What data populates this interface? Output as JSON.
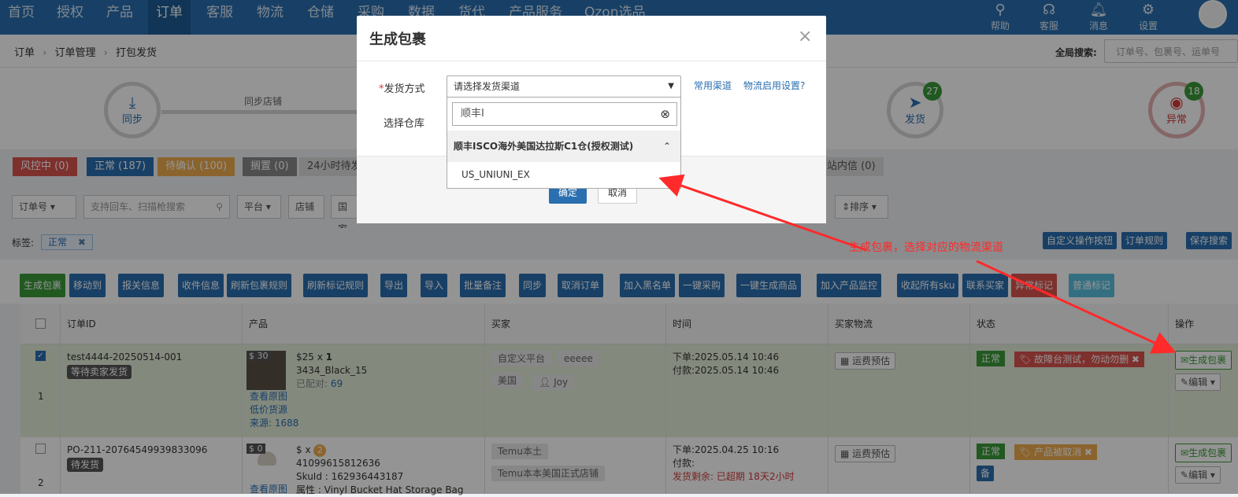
{
  "nav": {
    "items": [
      "首页",
      "授权",
      "产品",
      "订单",
      "客服",
      "物流",
      "仓储",
      "采购",
      "数据",
      "货代",
      "产品服务",
      "Ozon选品"
    ],
    "active_index": 3,
    "right": [
      {
        "label": "帮助",
        "icon": "search-icon"
      },
      {
        "label": "客服",
        "icon": "headset-icon"
      },
      {
        "label": "消息",
        "icon": "bell-icon"
      },
      {
        "label": "设置",
        "icon": "gear-icon"
      }
    ],
    "accent": "#2a6fb0"
  },
  "breadcrumb": {
    "items": [
      "订单",
      "订单管理",
      "打包发货"
    ],
    "separator": "›"
  },
  "global_search": {
    "label": "全局搜索:",
    "placeholder": "订单号、包裹号、运单号"
  },
  "flow": {
    "sync_label": "同步",
    "sync_line_label": "同步店铺",
    "ship_label": "发货",
    "ship_count": "27",
    "abnormal_label": "异常",
    "abnormal_count": "18"
  },
  "status_tabs": [
    {
      "label": "风控中 (0)",
      "color": "#d9534f"
    },
    {
      "label": "正常 (187)",
      "color": "#2a6fb0"
    },
    {
      "label": "待确认 (100)",
      "color": "#f0ad4e"
    },
    {
      "label": "搁置 (0)",
      "color": "#888888"
    },
    {
      "label": "24小时待发",
      "color": "#dddddd"
    },
    {
      "label": "站内信 (0)",
      "color": "#dddddd"
    }
  ],
  "filters": {
    "order_no": "订单号",
    "search_placeholder": "支持回车、扫描枪搜索",
    "platform": "平台",
    "store": "店铺",
    "country": "国家",
    "sort": "排序"
  },
  "label_row": {
    "label": "标签:",
    "tag": "正常"
  },
  "right_buttons": [
    "自定义操作按钮",
    "订单规则",
    "保存搜索"
  ],
  "actions": [
    {
      "label": "生成包裹",
      "color": "#3a9a3a"
    },
    {
      "label": "移动到",
      "color": "#2a6fb0"
    },
    {
      "label": "报关信息",
      "color": "#2a6fb0"
    },
    {
      "label": "收件信息",
      "color": "#2a6fb0"
    },
    {
      "label": "刷新包裹规则",
      "color": "#2a6fb0"
    },
    {
      "label": "刷新标记规则",
      "color": "#2a6fb0"
    },
    {
      "label": "导出",
      "color": "#2a6fb0"
    },
    {
      "label": "导入",
      "color": "#2a6fb0"
    },
    {
      "label": "批量备注",
      "color": "#2a6fb0"
    },
    {
      "label": "同步",
      "color": "#2a6fb0"
    },
    {
      "label": "取消订单",
      "color": "#2a6fb0"
    },
    {
      "label": "加入黑名单",
      "color": "#2a6fb0"
    },
    {
      "label": "一键采购",
      "color": "#2a6fb0"
    },
    {
      "label": "一键生成商品",
      "color": "#2a6fb0"
    },
    {
      "label": "加入产品监控",
      "color": "#2a6fb0"
    },
    {
      "label": "收起所有sku",
      "color": "#2a6fb0"
    },
    {
      "label": "联系买家",
      "color": "#2a6fb0"
    },
    {
      "label": "异常标记",
      "color": "#d9534f"
    },
    {
      "label": "普通标记",
      "color": "#5bc0de"
    }
  ],
  "table": {
    "headers": [
      "订单ID",
      "产品",
      "买家",
      "时间",
      "买家物流",
      "状态",
      "操作"
    ],
    "rows": [
      {
        "index": "1",
        "checked": true,
        "order_id": "test4444-20250514-001",
        "order_tag": "等待卖家发货",
        "price_badge": "$ 30",
        "price": "$25 x ",
        "qty": "1",
        "sku": "3434_Black_15",
        "matched_label": "已配对:",
        "matched_value": "69",
        "link1": "查看原图",
        "link2": "低价货源",
        "source_label": "来源:",
        "source_value": "1688",
        "buyer_platform": "自定义平台",
        "buyer_name": "eeeee",
        "buyer_country": "美国",
        "buyer_user": "Joy",
        "time_order": "下单:2025.05.14 10:46",
        "time_pay": "付款:2025.05.14 10:46",
        "logistics_btn": "运费预估",
        "status": "正常",
        "status_tag": "故障台测试，勿动勿删",
        "op_main": "生成包裹",
        "op_edit": "编辑"
      },
      {
        "index": "2",
        "checked": false,
        "order_id": "PO-211-20764549939833096",
        "order_tag": "待发货",
        "price_badge": "$ 0",
        "price": "$ x ",
        "qty": "2",
        "sku": "41099615812636",
        "skuid": "SkuId : 162936443187",
        "attr": "属性 : Vinyl Bucket Hat Storage Bag",
        "link1": "查看原图",
        "buyer_platform": "Temu本土",
        "buyer_name": "Temu本本美国正式店铺",
        "time_order": "下单:2025.04.25 10:16",
        "time_pay": "付款:",
        "time_remain": "发货剩余: 已超期 18天2小时",
        "logistics_btn": "运费预估",
        "status": "正常",
        "status_tag": "产品被取消",
        "note_tag": "备",
        "op_main": "生成包裹",
        "op_edit": "编辑"
      }
    ]
  },
  "modal": {
    "title": "生成包裹",
    "close": "×",
    "ship_method_label": "发货方式",
    "required_mark": "*",
    "select_placeholder": "请选择发货渠道",
    "link_common": "常用渠道",
    "link_settings": "物流启用设置?",
    "warehouse_label": "选择仓库",
    "search_value": "顺丰I",
    "group_title": "顺丰ISCO海外美国达拉斯C1仓(授权测试)",
    "option": "US_UNIUNI_EX",
    "confirm": "确定",
    "cancel": "取消"
  },
  "annotation": {
    "text": "生成包裹，选择对应的物流渠道",
    "color": "#ff2a2a"
  }
}
